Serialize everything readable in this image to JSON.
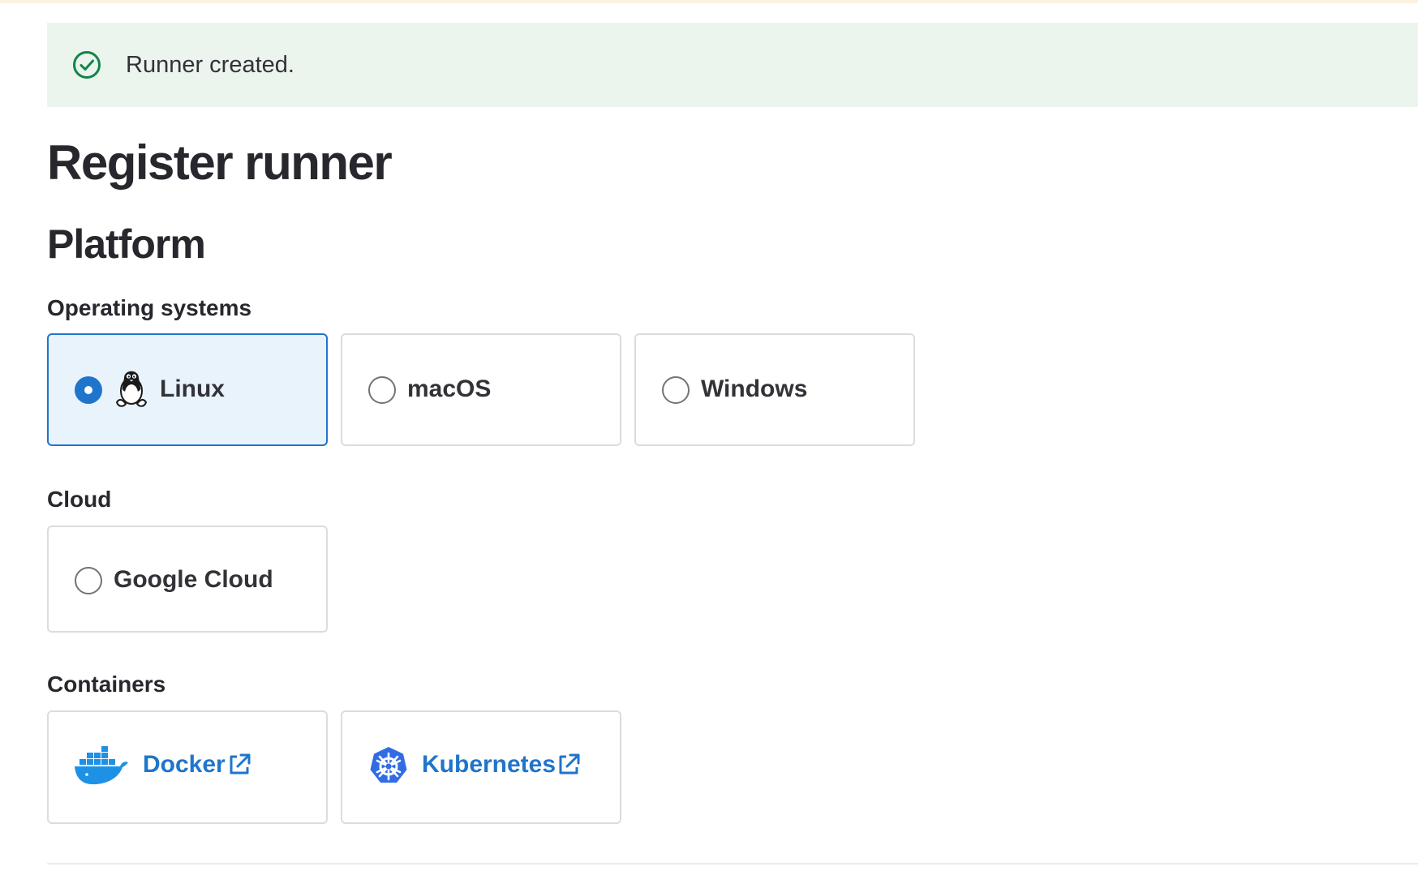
{
  "alert": {
    "message": "Runner created.",
    "icon": "check-circle-icon",
    "color": "#108548"
  },
  "page": {
    "title": "Register runner",
    "section_title": "Platform"
  },
  "operating_systems": {
    "label": "Operating systems",
    "options": [
      {
        "label": "Linux",
        "selected": true,
        "icon": "linux-tux-icon"
      },
      {
        "label": "macOS",
        "selected": false
      },
      {
        "label": "Windows",
        "selected": false
      }
    ]
  },
  "cloud": {
    "label": "Cloud",
    "options": [
      {
        "label": "Google Cloud",
        "selected": false
      }
    ]
  },
  "containers": {
    "label": "Containers",
    "links": [
      {
        "label": "Docker",
        "icon": "docker-whale-icon",
        "external_icon": "external-link-icon"
      },
      {
        "label": "Kubernetes",
        "icon": "kubernetes-helm-icon",
        "external_icon": "external-link-icon"
      }
    ]
  },
  "colors": {
    "accent": "#1f75cb",
    "success": "#108548",
    "selected_bg": "#e9f3fc",
    "alert_bg": "#ecf4ee"
  }
}
